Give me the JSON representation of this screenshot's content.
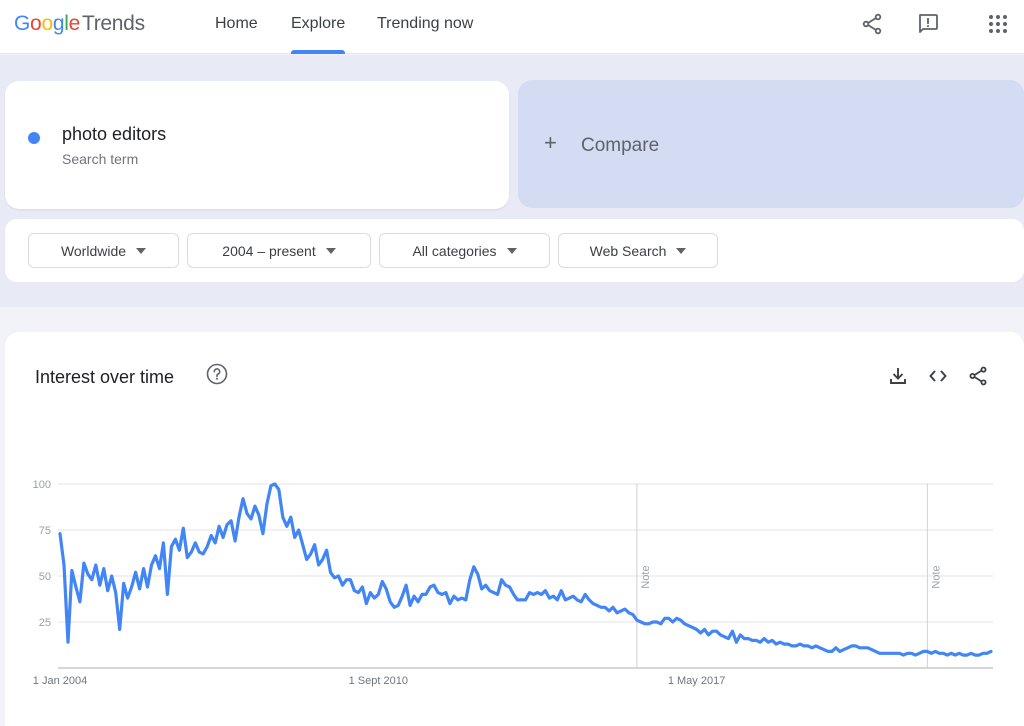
{
  "app": {
    "logo_letters": [
      "G",
      "o",
      "o",
      "g",
      "l",
      "e"
    ],
    "logo_product": "Trends"
  },
  "nav": {
    "home": "Home",
    "explore": "Explore",
    "trending": "Trending now",
    "active": "Explore"
  },
  "header_icons": [
    "share-icon",
    "feedback-icon",
    "apps-grid-icon"
  ],
  "search_term": {
    "name": "photo editors",
    "type": "Search term",
    "color": "#4285f4"
  },
  "compare": {
    "label": "Compare"
  },
  "filters": {
    "region": "Worldwide",
    "time_range": "2004 – present",
    "category": "All categories",
    "search_type": "Web Search"
  },
  "chart_card": {
    "title": "Interest over time",
    "actions": [
      "download-icon",
      "embed-icon",
      "share-icon"
    ]
  },
  "chart_data": {
    "type": "line",
    "title": "Interest over time",
    "xlabel": "",
    "ylabel": "",
    "ylim": [
      0,
      100
    ],
    "yticks": [
      25,
      50,
      75,
      100
    ],
    "x_tick_labels": [
      {
        "label": "1 Jan 2004",
        "month_index": 0
      },
      {
        "label": "1 Sept 2010",
        "month_index": 80
      },
      {
        "label": "1 May 2017",
        "month_index": 160
      }
    ],
    "notes": [
      {
        "label": "Note",
        "month_index": 145
      },
      {
        "label": "Note",
        "month_index": 218
      }
    ],
    "grid": true,
    "legend": "none",
    "series": [
      {
        "name": "photo editors",
        "color": "#4285f4",
        "start": "2004-01",
        "frequency": "monthly",
        "values": [
          73,
          56,
          14,
          53,
          44,
          36,
          57,
          51,
          48,
          56,
          45,
          54,
          42,
          50,
          41,
          21,
          46,
          38,
          44,
          52,
          43,
          54,
          44,
          56,
          61,
          54,
          68,
          40,
          66,
          70,
          64,
          76,
          60,
          63,
          68,
          63,
          62,
          66,
          72,
          68,
          77,
          71,
          78,
          80,
          69,
          82,
          92,
          84,
          81,
          88,
          83,
          73,
          89,
          99,
          100,
          97,
          82,
          77,
          82,
          71,
          75,
          67,
          59,
          62,
          67,
          56,
          59,
          64,
          52,
          49,
          50,
          45,
          48,
          48,
          42,
          41,
          44,
          35,
          41,
          38,
          40,
          47,
          43,
          36,
          33,
          34,
          39,
          45,
          34,
          39,
          36,
          40,
          40,
          44,
          45,
          41,
          40,
          41,
          35,
          39,
          37,
          38,
          37,
          48,
          55,
          51,
          43,
          45,
          42,
          41,
          40,
          48,
          45,
          44,
          40,
          37,
          37,
          37,
          41,
          40,
          41,
          40,
          42,
          38,
          39,
          37,
          42,
          37,
          38,
          39,
          37,
          36,
          40,
          37,
          35,
          34,
          33,
          33,
          31,
          33,
          30,
          31,
          32,
          30,
          29,
          26,
          25,
          24,
          24,
          25,
          25,
          24,
          27,
          27,
          25,
          27,
          26,
          24,
          23,
          22,
          21,
          19,
          21,
          18,
          20,
          20,
          18,
          17,
          16,
          20,
          14,
          18,
          16,
          16,
          15,
          15,
          14,
          16,
          14,
          15,
          13,
          14,
          13,
          13,
          12,
          12,
          13,
          12,
          12,
          11,
          12,
          11,
          10,
          9,
          9,
          11,
          9,
          10,
          11,
          12,
          12,
          11,
          11,
          11,
          10,
          9,
          8,
          8,
          8,
          8,
          8,
          8,
          7,
          8,
          8,
          7,
          8,
          9,
          9,
          8,
          9,
          8,
          8,
          7,
          8,
          7,
          8,
          7,
          7,
          8,
          7,
          7,
          8,
          8,
          9
        ]
      }
    ]
  }
}
